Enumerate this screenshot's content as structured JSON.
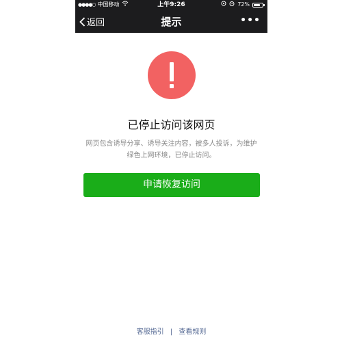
{
  "status_bar": {
    "signal": "●●●●○",
    "carrier": "中国移动",
    "wifi_icon": "wifi-icon",
    "time": "上午9:26",
    "battery_percent": "72%",
    "battery_level": 0.72
  },
  "nav": {
    "back_label": "返回",
    "title": "提示",
    "more_label": "•••"
  },
  "alert": {
    "mark": "!",
    "color": "#f26262"
  },
  "content": {
    "headline": "已停止访问该网页",
    "description": "网页包含诱导分享、诱导关注内容，被多人投诉，为维护绿色上网环境，已停止访问。",
    "button_label": "申请恢复访问",
    "button_color": "#1aad19"
  },
  "footer": {
    "link_guide": "客服指引",
    "separator": "|",
    "link_rules": "查看规则"
  }
}
